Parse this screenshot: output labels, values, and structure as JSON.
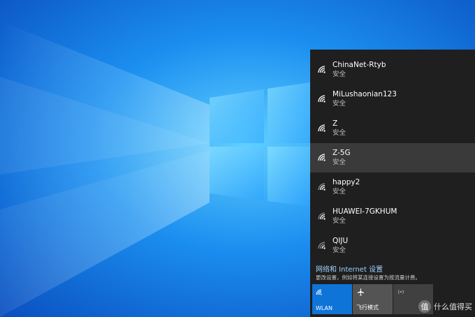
{
  "networks": [
    {
      "name": "ChinaNet-Rtyb",
      "status": "安全"
    },
    {
      "name": "MiLushaonian123",
      "status": "安全"
    },
    {
      "name": "Z",
      "status": "安全"
    },
    {
      "name": "Z-5G",
      "status": "安全"
    },
    {
      "name": "happy2",
      "status": "安全"
    },
    {
      "name": "HUAWEI-7GKHUM",
      "status": "安全"
    },
    {
      "name": "QIJU",
      "status": "安全"
    }
  ],
  "selected_network_index": 3,
  "settings": {
    "link": "网络和 Internet 设置",
    "description": "更改设置，例如将某连接设置为按流量计费。"
  },
  "tiles": {
    "wlan": "WLAN",
    "airplane": "飞行模式",
    "hotspot": ""
  },
  "watermark": {
    "text": "什么值得买",
    "badge": "值"
  },
  "colors": {
    "panel_bg": "#1f1f1f",
    "selected_bg": "#3a3a3a",
    "accent": "#0f74d8",
    "link": "#9fd0ff",
    "desktop": "#0a6fd6"
  }
}
